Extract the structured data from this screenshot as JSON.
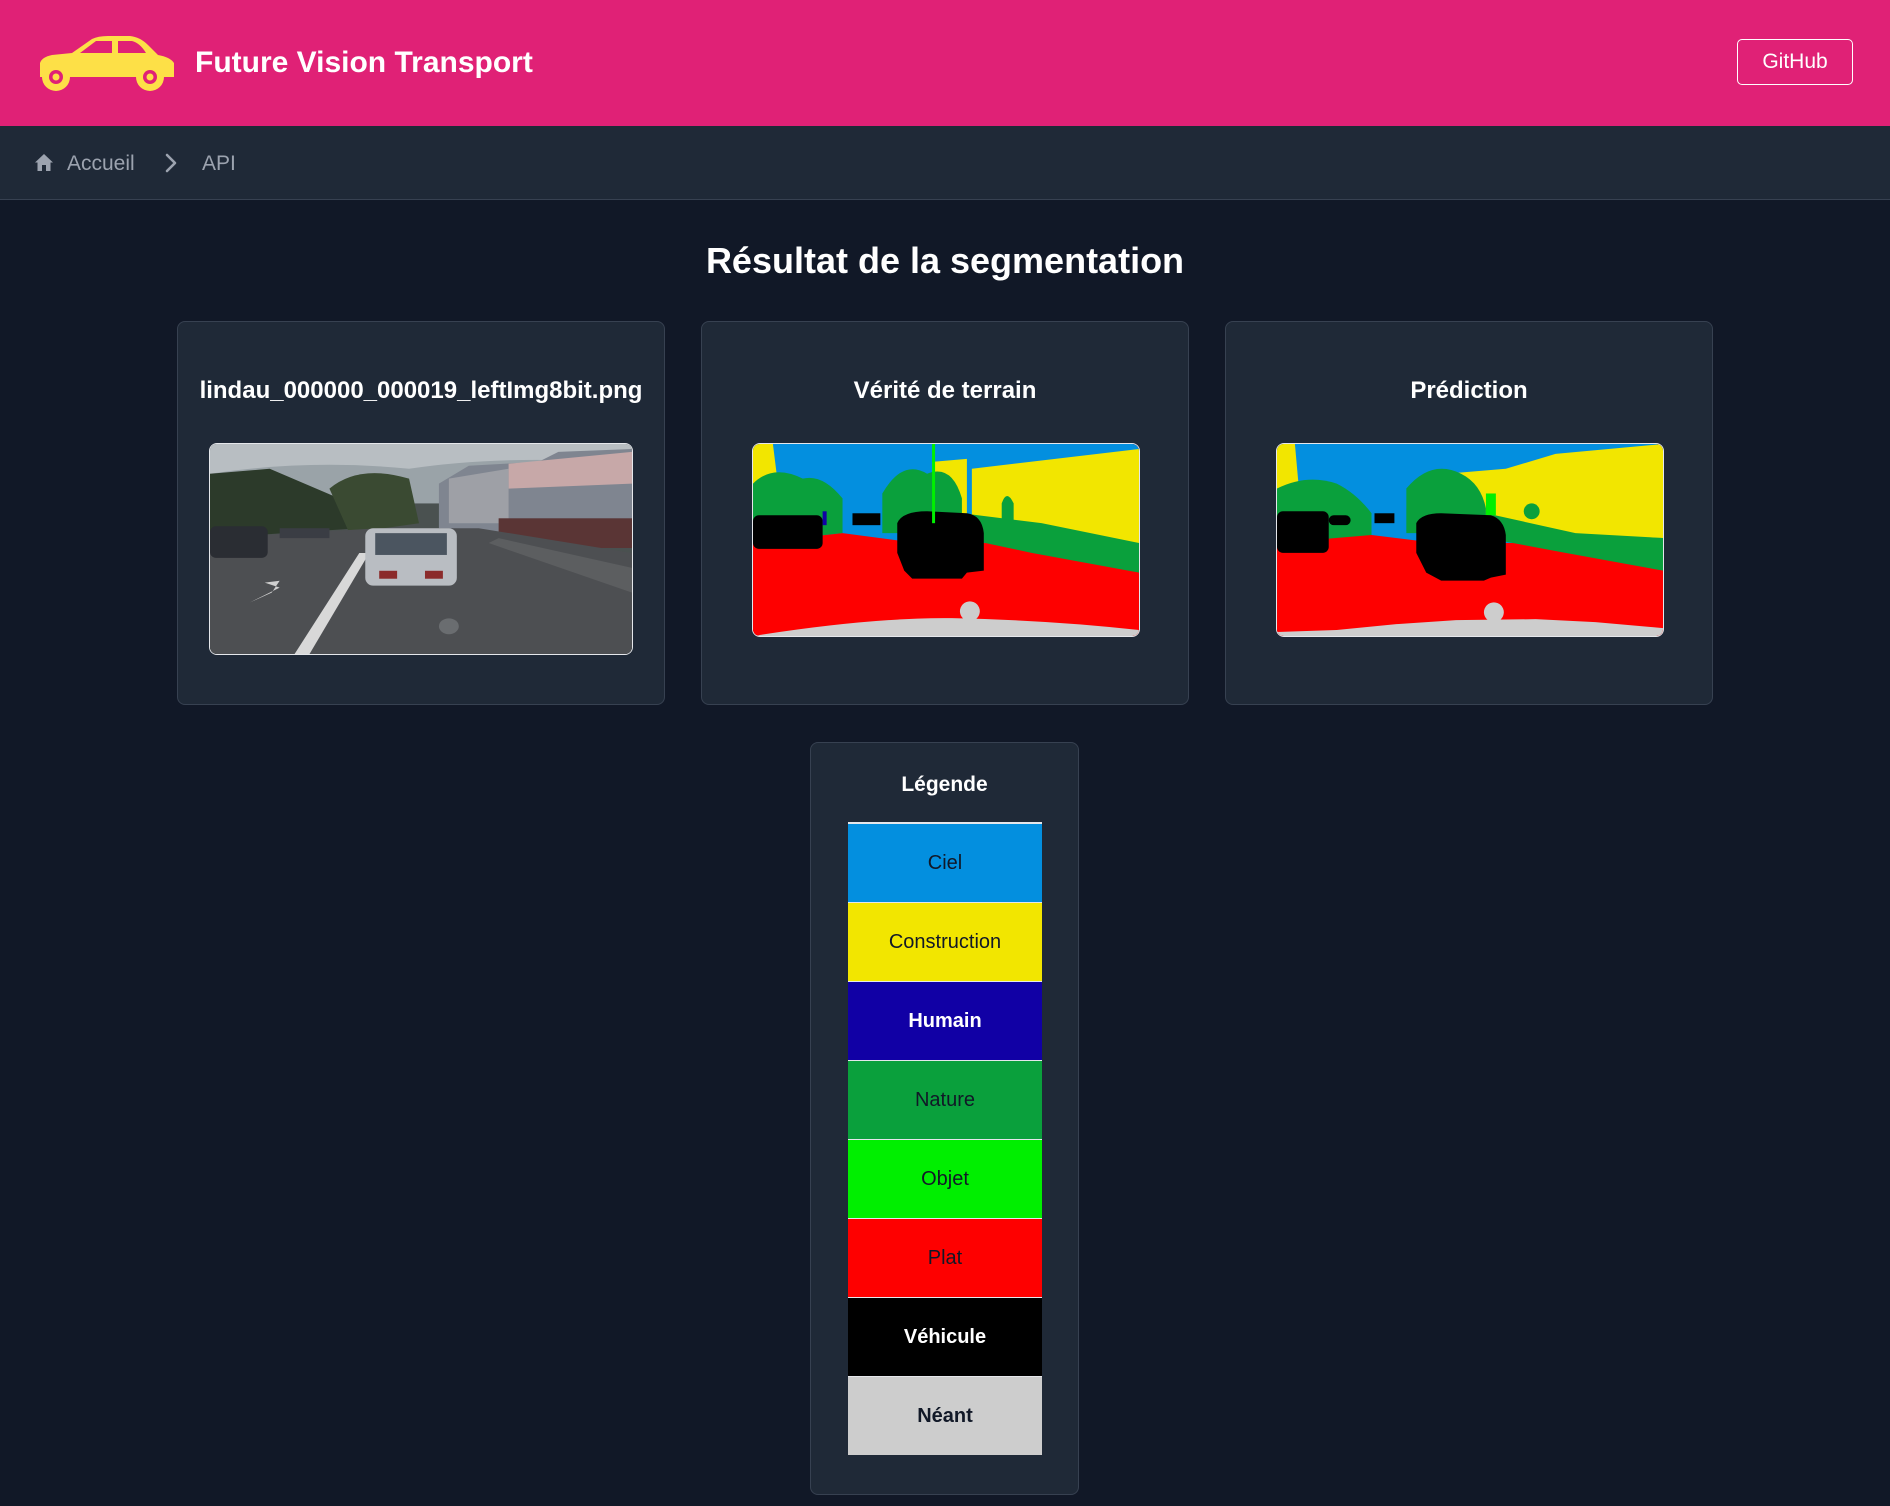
{
  "header": {
    "brand": "Future Vision Transport",
    "github_label": "GitHub",
    "logo_icon": "car-icon",
    "brand_color": "#e02176",
    "logo_color": "#fde047"
  },
  "breadcrumb": {
    "home_icon": "home-icon",
    "home_label": "Accueil",
    "separator_icon": "chevron-right-icon",
    "current_label": "API"
  },
  "main": {
    "title": "Résultat de la segmentation",
    "cards": [
      {
        "title": "lindau_000000_000019_leftImg8bit.png",
        "kind": "original-photo"
      },
      {
        "title": "Vérité de terrain",
        "kind": "ground-truth-mask"
      },
      {
        "title": "Prédiction",
        "kind": "prediction-mask"
      }
    ]
  },
  "legend": {
    "title": "Légende",
    "items": [
      {
        "label": "Ciel",
        "color": "#038fdf",
        "text_color": "#111827",
        "bold": false
      },
      {
        "label": "Construction",
        "color": "#f2e600",
        "text_color": "#111827",
        "bold": false
      },
      {
        "label": "Humain",
        "color": "#1100a5",
        "text_color": "#ffffff",
        "bold": true
      },
      {
        "label": "Nature",
        "color": "#0aa03c",
        "text_color": "#111827",
        "bold": false
      },
      {
        "label": "Objet",
        "color": "#00ef00",
        "text_color": "#111827",
        "bold": false
      },
      {
        "label": "Plat",
        "color": "#fe0000",
        "text_color": "#111827",
        "bold": false
      },
      {
        "label": "Véhicule",
        "color": "#000000",
        "text_color": "#ffffff",
        "bold": true
      },
      {
        "label": "Néant",
        "color": "#cdcdcd",
        "text_color": "#111827",
        "bold": true
      }
    ]
  }
}
